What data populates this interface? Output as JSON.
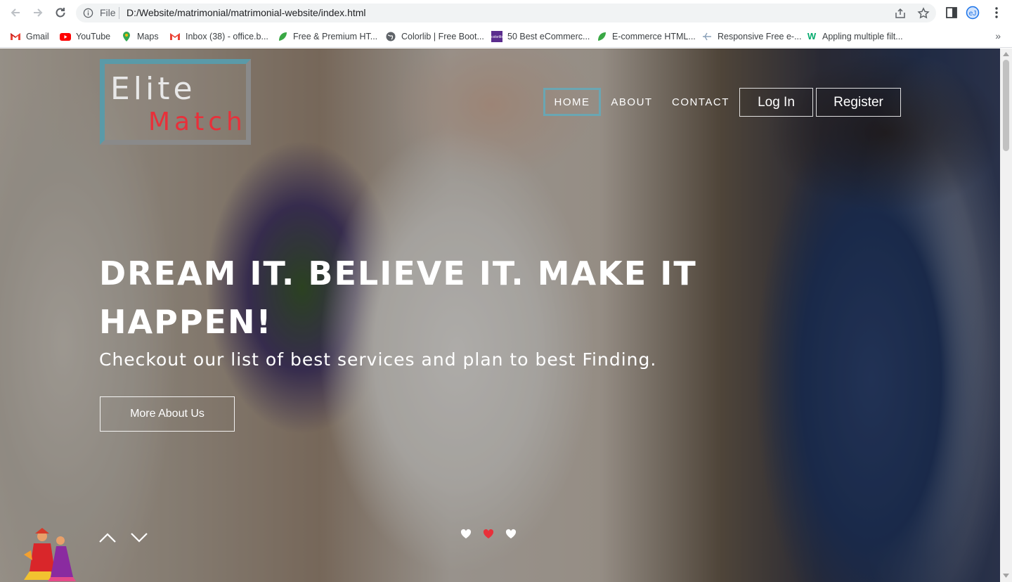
{
  "browser": {
    "omnibox": {
      "scheme_label": "File",
      "url": "D:/Website/matrimonial/matrimonial-website/index.html"
    },
    "bookmarks": [
      {
        "label": "Gmail",
        "icon": "gmail-icon"
      },
      {
        "label": "YouTube",
        "icon": "youtube-icon"
      },
      {
        "label": "Maps",
        "icon": "maps-icon"
      },
      {
        "label": "Inbox (38) - office.b...",
        "icon": "gmail-icon"
      },
      {
        "label": "Free & Premium HT...",
        "icon": "leaf-icon"
      },
      {
        "label": "Colorlib | Free Boot...",
        "icon": "globe-icon"
      },
      {
        "label": "50 Best eCommerc...",
        "icon": "colorlib-icon"
      },
      {
        "label": "E-commerce HTML...",
        "icon": "leaf-icon"
      },
      {
        "label": "Responsive Free e-...",
        "icon": "free-icon"
      },
      {
        "label": "Appling multiple filt...",
        "icon": "w3schools-icon"
      }
    ],
    "more_bookmarks": "»"
  },
  "site": {
    "logo": {
      "line1": "Elite",
      "line2": "Match"
    },
    "nav": {
      "home": "HOME",
      "about": "ABOUT",
      "contact": "CONTACT",
      "login": "Log In",
      "register": "Register"
    },
    "hero": {
      "headline": "DREAM IT. BELIEVE IT. MAKE IT HAPPEN!",
      "subline": "Checkout our list of best services and plan to best Finding.",
      "cta": "More About Us",
      "active_slide": 2,
      "slide_count": 3
    }
  },
  "colors": {
    "accent_red": "#e8303a",
    "nav_active_border": "#6aa6b3",
    "logo_border_teal": "#5a9aa8"
  }
}
